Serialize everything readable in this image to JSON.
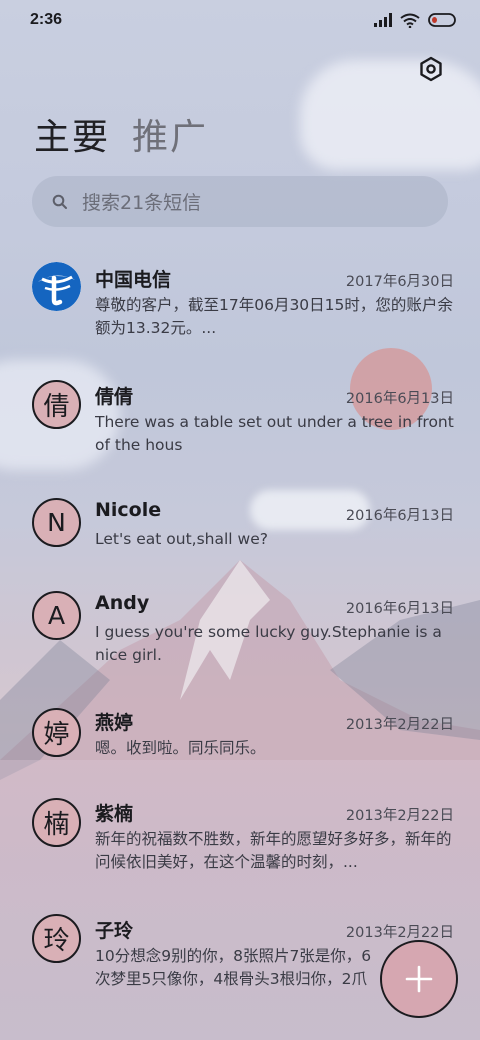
{
  "status_bar": {
    "time": "2:36",
    "icons": [
      "signal-icon",
      "wifi-icon",
      "battery-icon"
    ]
  },
  "header": {
    "settings_icon": "settings-icon",
    "tabs": [
      {
        "label": "主要",
        "active": true
      },
      {
        "label": "推广",
        "active": false
      }
    ]
  },
  "search": {
    "placeholder": "搜索21条短信",
    "icon": "search-icon"
  },
  "conversations": [
    {
      "name": "中国电信",
      "avatar": "",
      "avatar_type": "logo",
      "date": "2017年6月30日",
      "preview": "尊敬的客户，截至17年06月30日15时，您的账户余额为13.32元。..."
    },
    {
      "name": "倩倩",
      "avatar": "倩",
      "avatar_type": "char",
      "date": "2016年6月13日",
      "preview": "There was a table set out under a tree in front of the hous"
    },
    {
      "name": "Nicole",
      "avatar": "N",
      "avatar_type": "letter",
      "date": "2016年6月13日",
      "preview": "Let's eat out,shall we?"
    },
    {
      "name": "Andy",
      "avatar": "A",
      "avatar_type": "letter",
      "date": "2016年6月13日",
      "preview": "I guess you're some lucky guy.Stephanie is a nice girl."
    },
    {
      "name": "燕婷",
      "avatar": "婷",
      "avatar_type": "char",
      "date": "2013年2月22日",
      "preview": "嗯。收到啦。同乐同乐。"
    },
    {
      "name": "紫楠",
      "avatar": "楠",
      "avatar_type": "char",
      "date": "2013年2月22日",
      "preview": "新年的祝福数不胜数，新年的愿望好多好多，新年的问候依旧美好，在这个温馨的时刻，..."
    },
    {
      "name": "子玲",
      "avatar": "玲",
      "avatar_type": "char",
      "date": "2013年2月22日",
      "preview": "10分想念9别的你，8张照片7张是你，6次梦里5只像你，4根骨头3根归你，2爪着地"
    }
  ],
  "fab": {
    "icon": "plus-icon"
  },
  "colors": {
    "avatar_fill": "#d9b0b6",
    "fab_fill": "#d6a7b1",
    "telecom_blue": "#1565c0"
  }
}
